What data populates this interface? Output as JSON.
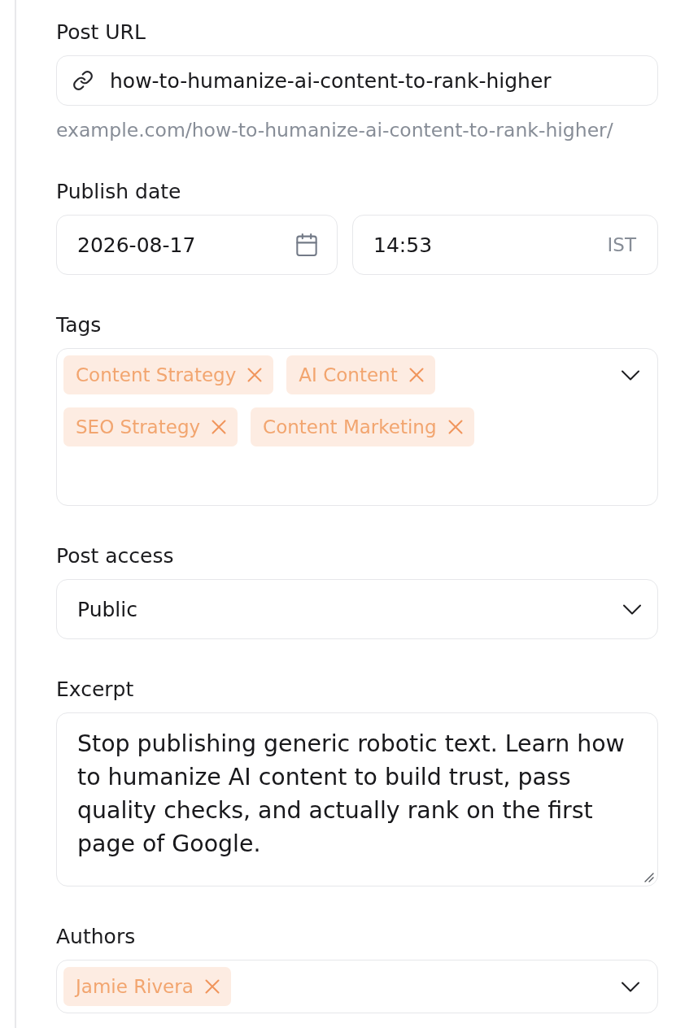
{
  "fields": [
    {
      "kind": "url",
      "label": "Post URL",
      "value": "how-to-humanize-ai-content-to-rank-higher",
      "helper": "example.com/how-to-humanize-ai-content-to-rank-higher/"
    },
    {
      "kind": "datetime",
      "label": "Publish date",
      "date": "2026-08-17",
      "time": "14:53",
      "timezone": "IST"
    },
    {
      "kind": "tags",
      "label": "Tags",
      "items": [
        "Content Strategy",
        "AI Content",
        "SEO Strategy",
        "Content Marketing"
      ]
    },
    {
      "kind": "select",
      "label": "Post access",
      "value": "Public"
    },
    {
      "kind": "textarea",
      "label": "Excerpt",
      "value": "Stop publishing generic robotic text. Learn how to humanize AI content to build trust, pass quality checks, and actually rank on the first page of Google."
    },
    {
      "kind": "authors",
      "label": "Authors",
      "items": [
        "Jamie Rivera"
      ]
    }
  ]
}
